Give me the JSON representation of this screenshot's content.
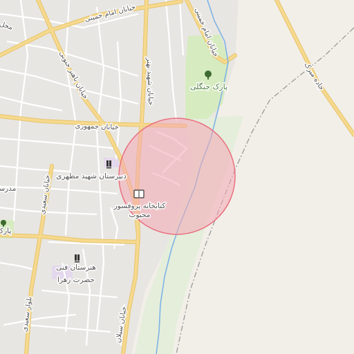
{
  "map": {
    "colors": {
      "background": "#f2efe9",
      "urban": "#e8e6e2",
      "park": "#d7ebc1",
      "river_corridor": "#e4eedb",
      "major_road": "#f6d98e",
      "major_road_casing": "#e6c46a",
      "minor_road": "#ffffff",
      "river": "#7fb3e6",
      "circle_fill": "#f4a7b5",
      "circle_stroke": "#e9707f",
      "rail": "#9a9a9a"
    },
    "labels": {
      "park_jangali": "پارک جنگلی",
      "street_emam_khomeini_top": "خیابان امام خمینی",
      "street_emam_khomeini_right": "خیابان امام خمینی",
      "street_bahonar": "خیابان باهنر جنوبی",
      "street_shahid_bahonar": "خیابان شهید بهنر",
      "street_jomhouri": "خیابان جمهوری",
      "street_saidi": "خیابان سعیدی",
      "street_saidi_lower": "بلوار سعیدی",
      "street_seylan": "خیابان سیلان",
      "road_jade_mirak": "جاده میرک",
      "school_motahari": "دبیرستان شهید مطهری",
      "library_line1": "کتابخانه پروفسور",
      "library_line2": "محبوب",
      "vocational_line1": "هنرستان فنی",
      "vocational_line2": "حضرت زهرا",
      "park_left": "پارک",
      "madrese_left": "مدرسه",
      "top_left_fragment": "محل"
    },
    "icons": [
      "tree-icon",
      "school-icon",
      "library-icon"
    ],
    "highlight_circle": {
      "label": ""
    }
  }
}
